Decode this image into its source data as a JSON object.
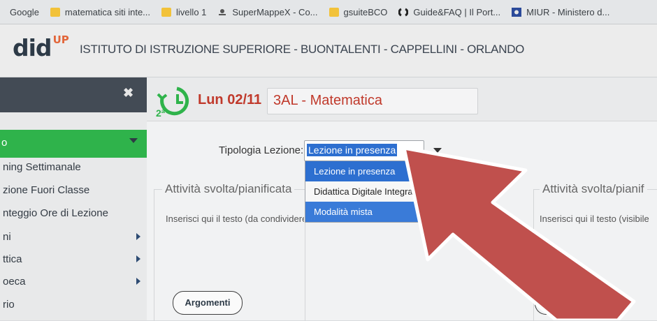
{
  "bookmarks": [
    {
      "label": "Google",
      "icon": "none"
    },
    {
      "label": "matematica siti inte...",
      "icon": "folder-icon"
    },
    {
      "label": "livello 1",
      "icon": "folder-icon"
    },
    {
      "label": "SuperMappeX - Co...",
      "icon": "supermappe-icon"
    },
    {
      "label": "gsuiteBCO",
      "icon": "folder-icon"
    },
    {
      "label": "Guide&FAQ | Il Port...",
      "icon": "portal-icon"
    },
    {
      "label": "MIUR - Ministero d...",
      "icon": "miur-icon"
    }
  ],
  "header": {
    "logo_main": "did",
    "logo_sup": "UP",
    "school": "ISTITUTO DI ISTRUZIONE SUPERIORE - BUONTALENTI - CAPPELLINI - ORLANDO"
  },
  "sidebar": {
    "close_glyph": "✖",
    "active_item": "o",
    "items": [
      {
        "label": "ning Settimanale",
        "has_arrow": false
      },
      {
        "label": "zione Fuori Classe",
        "has_arrow": false
      },
      {
        "label": "nteggio Ore di Lezione",
        "has_arrow": false
      },
      {
        "label": "ni",
        "has_arrow": true
      },
      {
        "label": "ttica",
        "has_arrow": true
      },
      {
        "label": "oeca",
        "has_arrow": true
      },
      {
        "label": "rio",
        "has_arrow": false
      }
    ]
  },
  "main": {
    "hour_label": "2ª",
    "date": "Lun 02/11",
    "class_subject": "3AL - Matematica",
    "tipologia_label": "Tipologia Lezione:",
    "tipologia_value": "Lezione in presenza",
    "dropdown_options": [
      {
        "label": "Lezione in presenza",
        "state": "selected"
      },
      {
        "label": "Didattica Digitale Integrata",
        "state": "normal"
      },
      {
        "label": "Modalità mista",
        "state": "hover"
      }
    ],
    "left_panel_title": "Attività svolta/pianificata",
    "left_panel_placeholder": "Inserisci qui il testo (da condividere)",
    "right_panel_title": "Attività svolta/pianif",
    "right_panel_placeholder": "Inserisci qui il testo (visibile",
    "argomenti_label": "Argomenti"
  },
  "colors": {
    "accent_green": "#2fb34b",
    "brand_red": "#c0392b",
    "selection_blue": "#2d6fd0",
    "arrow_red": "#c0504d"
  }
}
